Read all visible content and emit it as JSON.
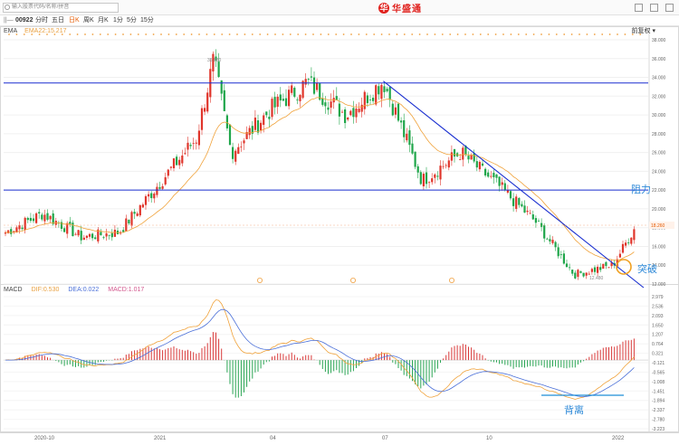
{
  "toolbar": {
    "search_placeholder": "输入股票代码/名称/拼音",
    "brand": "华盛通",
    "logo_mark": "华"
  },
  "period_bar": {
    "code": "00922",
    "items": [
      "分时",
      "五日",
      "日K",
      "周K",
      "月K",
      "1分",
      "5分",
      "15分"
    ],
    "active": "日K"
  },
  "ema_legend": {
    "name": "EMA",
    "value": "EMA22:15.217"
  },
  "adjust_label": "前复权",
  "macd_legend": {
    "name": "MACD",
    "dif": "DIF:0.530",
    "dea": "DEA:0.022",
    "macd": "MACD:1.017"
  },
  "price_axis": [
    "38.000",
    "36.000",
    "34.000",
    "32.000",
    "30.000",
    "28.000",
    "26.000",
    "24.000",
    "22.000",
    "20.000",
    "18.000",
    "16.000",
    "14.000",
    "12.000"
  ],
  "macd_axis": [
    "2.979",
    "2.536",
    "2.093",
    "1.650",
    "1.207",
    "0.764",
    "0.321",
    "-0.121",
    "-0.565",
    "-1.008",
    "-1.451",
    "-1.894",
    "-2.337",
    "-2.780",
    "-3.223"
  ],
  "date_axis": [
    "2020-10",
    "2021",
    "04",
    "07",
    "10",
    "2022"
  ],
  "annotations": {
    "resistance": "阻力",
    "breakout": "突破",
    "divergence": "背离",
    "high_price": "35.880",
    "low_price": "12.480",
    "current_price": "18.260"
  },
  "chart_data": {
    "type": "candlestick",
    "price_ylim": [
      12,
      38
    ],
    "horizontal_levels": [
      33.4,
      22.0
    ],
    "trendline": {
      "from": {
        "date": "2021-07",
        "price": 33.6
      },
      "to": {
        "date": "2022-01",
        "price": 12.0
      }
    },
    "price_path": [
      [
        "2020-09",
        17.5
      ],
      [
        "2020-10",
        19.5
      ],
      [
        "2020-11",
        17.0
      ],
      [
        "2020-12",
        17.5
      ],
      [
        "2021-01",
        22.5
      ],
      [
        "2021-02",
        27.5
      ],
      [
        "2021-02-15",
        35.9
      ],
      [
        "2021-03",
        26.0
      ],
      [
        "2021-04",
        30.5
      ],
      [
        "2021-05",
        33.5
      ],
      [
        "2021-06",
        30.0
      ],
      [
        "2021-07",
        33.6
      ],
      [
        "2021-08",
        23.0
      ],
      [
        "2021-09",
        26.0
      ],
      [
        "2021-10",
        22.5
      ],
      [
        "2021-11",
        18.5
      ],
      [
        "2021-12",
        13.0
      ],
      [
        "2022-01",
        14.0
      ],
      [
        "2022-01-20",
        18.3
      ]
    ],
    "ema22_last": 15.217,
    "macd_ylim": [
      -3.223,
      2.979
    ],
    "macd_last": {
      "dif": 0.53,
      "dea": 0.022,
      "macd": 1.017
    }
  }
}
